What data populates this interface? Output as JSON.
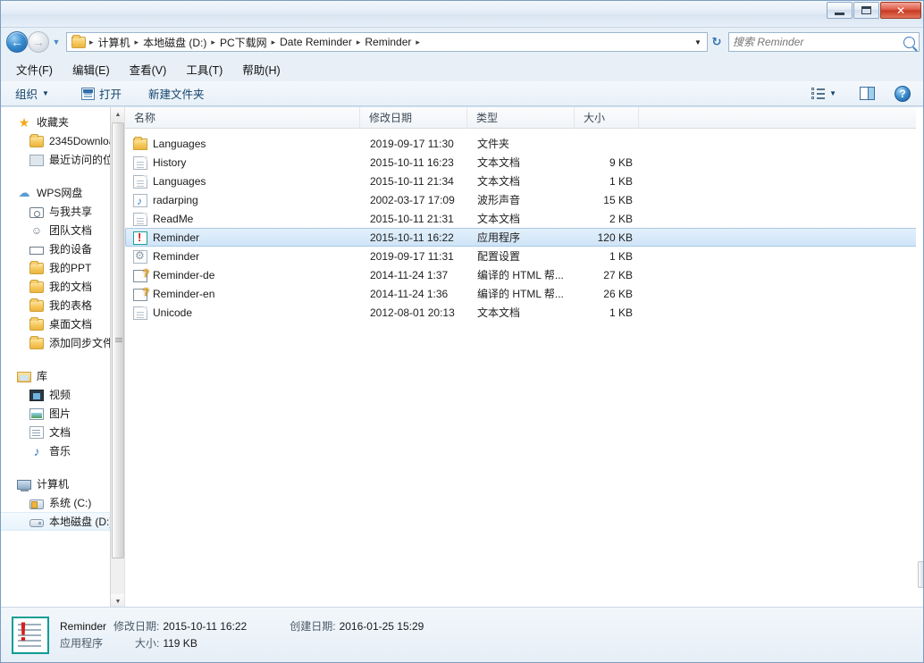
{
  "window": {
    "buttons": {
      "minimize": "minimize-icon",
      "maximize": "maximize-icon",
      "close": "✕"
    }
  },
  "address": {
    "back_icon": "←",
    "forward_icon": "→",
    "history_caret": "▼",
    "folder_icon": "folder-icon",
    "crumbs": [
      "计算机",
      "本地磁盘 (D:)",
      "PC下载网",
      "Date Reminder",
      "Reminder"
    ],
    "separator": "▸",
    "dropdown_caret": "▼",
    "refresh_icon": "↻"
  },
  "search": {
    "placeholder": "搜索 Reminder",
    "value": "",
    "icon": "search-icon"
  },
  "menubar": {
    "items": [
      "文件(F)",
      "编辑(E)",
      "查看(V)",
      "工具(T)",
      "帮助(H)"
    ]
  },
  "toolbar": {
    "organize": "组织",
    "organize_caret": "▼",
    "open": "打开",
    "new_folder": "新建文件夹",
    "view_caret": "▼",
    "help": "?"
  },
  "sidebar": {
    "groups": [
      {
        "name": "favorites",
        "header": {
          "label": "收藏夹",
          "icon": "star-icon",
          "icon_class": "ic-star",
          "glyph": "★"
        },
        "items": [
          {
            "label": "2345Downloa",
            "icon": "folder-icon",
            "icon_class": "ic-folder"
          },
          {
            "label": "最近访问的位置",
            "icon": "recent-places-icon",
            "icon_class": "ic-link"
          }
        ]
      },
      {
        "name": "wps-cloud",
        "header": {
          "label": "WPS网盘",
          "icon": "cloud-icon",
          "icon_class": "ic-cloud",
          "glyph": "☁"
        },
        "items": [
          {
            "label": "与我共享",
            "icon": "shared-with-me-icon",
            "icon_class": "ic-share"
          },
          {
            "label": "团队文档",
            "icon": "team-docs-icon",
            "icon_class": "ic-team",
            "glyph": "☺"
          },
          {
            "label": "我的设备",
            "icon": "my-devices-icon",
            "icon_class": "ic-device"
          },
          {
            "label": "我的PPT",
            "icon": "folder-icon",
            "icon_class": "ic-folder"
          },
          {
            "label": "我的文档",
            "icon": "folder-icon",
            "icon_class": "ic-folder"
          },
          {
            "label": "我的表格",
            "icon": "folder-icon",
            "icon_class": "ic-folder"
          },
          {
            "label": "桌面文档",
            "icon": "folder-icon",
            "icon_class": "ic-folder"
          },
          {
            "label": "添加同步文件夹",
            "icon": "folder-icon",
            "icon_class": "ic-folder"
          }
        ]
      },
      {
        "name": "libraries",
        "header": {
          "label": "库",
          "icon": "library-icon",
          "icon_class": "ic-lib"
        },
        "items": [
          {
            "label": "视频",
            "icon": "video-icon",
            "icon_class": "ic-video"
          },
          {
            "label": "图片",
            "icon": "pictures-icon",
            "icon_class": "ic-pic"
          },
          {
            "label": "文档",
            "icon": "documents-icon",
            "icon_class": "ic-doc"
          },
          {
            "label": "音乐",
            "icon": "music-icon",
            "icon_class": "ic-music",
            "glyph": "♪"
          }
        ]
      },
      {
        "name": "computer",
        "header": {
          "label": "计算机",
          "icon": "computer-icon",
          "icon_class": "ic-computer"
        },
        "items": [
          {
            "label": "系统 (C:)",
            "icon": "system-drive-icon",
            "icon_class": "ic-drivec"
          },
          {
            "label": "本地磁盘 (D:)",
            "icon": "local-disk-icon",
            "icon_class": "ic-drive",
            "selected": true
          }
        ]
      }
    ],
    "scroll_up": "▲",
    "scroll_down": "▼"
  },
  "filelist": {
    "columns": [
      "名称",
      "修改日期",
      "类型",
      "大小"
    ],
    "sort_column": "名称",
    "sort_direction": "ascending",
    "rows": [
      {
        "name": "Languages",
        "date": "2019-09-17 11:30",
        "type": "文件夹",
        "size": "",
        "icon": "folder-icon",
        "icon_class": "fi-folder",
        "selected": false
      },
      {
        "name": "History",
        "date": "2015-10-11 16:23",
        "type": "文本文档",
        "size": "9 KB",
        "icon": "text-file-icon",
        "icon_class": "fi-txt",
        "selected": false
      },
      {
        "name": "Languages",
        "date": "2015-10-11 21:34",
        "type": "文本文档",
        "size": "1 KB",
        "icon": "text-file-icon",
        "icon_class": "fi-txt",
        "selected": false
      },
      {
        "name": "radarping",
        "date": "2002-03-17 17:09",
        "type": "波形声音",
        "size": "15 KB",
        "icon": "wave-sound-icon",
        "icon_class": "fi-wav",
        "selected": false
      },
      {
        "name": "ReadMe",
        "date": "2015-10-11 21:31",
        "type": "文本文档",
        "size": "2 KB",
        "icon": "text-file-icon",
        "icon_class": "fi-txt",
        "selected": false
      },
      {
        "name": "Reminder",
        "date": "2015-10-11 16:22",
        "type": "应用程序",
        "size": "120 KB",
        "icon": "application-icon",
        "icon_class": "fi-app",
        "selected": true
      },
      {
        "name": "Reminder",
        "date": "2019-09-17 11:31",
        "type": "配置设置",
        "size": "1 KB",
        "icon": "config-settings-icon",
        "icon_class": "fi-cfg",
        "selected": false
      },
      {
        "name": "Reminder-de",
        "date": "2014-11-24 1:37",
        "type": "编译的 HTML 帮...",
        "size": "27 KB",
        "icon": "chm-help-icon",
        "icon_class": "fi-chm",
        "selected": false
      },
      {
        "name": "Reminder-en",
        "date": "2014-11-24 1:36",
        "type": "编译的 HTML 帮...",
        "size": "26 KB",
        "icon": "chm-help-icon",
        "icon_class": "fi-chm",
        "selected": false
      },
      {
        "name": "Unicode",
        "date": "2012-08-01 20:13",
        "type": "文本文档",
        "size": "1 KB",
        "icon": "text-file-icon",
        "icon_class": "fi-txt",
        "selected": false
      }
    ]
  },
  "details": {
    "icon": "application-icon",
    "name": "Reminder",
    "modified_label": "修改日期:",
    "modified_value": "2015-10-11 16:22",
    "created_label": "创建日期:",
    "created_value": "2016-01-25 15:29",
    "type": "应用程序",
    "size_label": "大小:",
    "size_value": "119 KB"
  }
}
